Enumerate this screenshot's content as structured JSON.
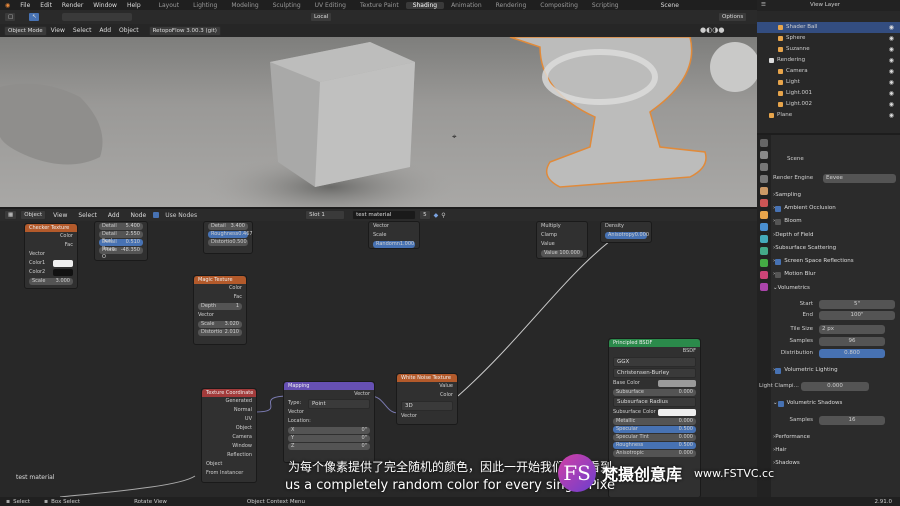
{
  "menu": [
    "File",
    "Edit",
    "Render",
    "Window",
    "Help"
  ],
  "workspaces": [
    "Layout",
    "Lighting",
    "Modeling",
    "Sculpting",
    "UV Editing",
    "Texture Paint",
    "Shading",
    "Animation",
    "Rendering",
    "Compositing",
    "Scripting"
  ],
  "active_workspace": "Shading",
  "scene_label": "Scene",
  "view_layer_label": "View Layer",
  "viewport": {
    "mode": "Object Mode",
    "menus": [
      "View",
      "Select",
      "Add",
      "Object"
    ],
    "addon": "RetopoFlow 3.00.3 (git)",
    "transform": "Local",
    "options": "Options"
  },
  "node_editor": {
    "editor_type": "Object",
    "menus": [
      "View",
      "Select",
      "Add",
      "Node"
    ],
    "use_nodes": "Use Nodes",
    "slot": "Slot 1",
    "material": "test material",
    "users": "5",
    "material_label": "test material"
  },
  "nodes": {
    "checker": {
      "title": "Checker Texture",
      "out": [
        "Color",
        "Fac"
      ],
      "in": [
        "Vector",
        "Color1",
        "Color2"
      ],
      "scale_label": "Scale",
      "scale": "3.000"
    },
    "noise_top": {
      "rows": [
        [
          "Detail",
          "5.400"
        ],
        [
          "Detail Scal",
          "2.550"
        ],
        [
          "Detail Roug",
          "0.510"
        ],
        [
          "Phase O",
          "-48.350"
        ]
      ]
    },
    "voronoi_top": {
      "rows": [
        [
          "Detail",
          "3.400"
        ],
        [
          "Roughness",
          "0.467"
        ],
        [
          "Distortio",
          "0.500"
        ]
      ]
    },
    "vec_top": {
      "rows": [
        "Vector",
        "Scale"
      ],
      "rand_label": "Randomn",
      "rand": "1.000"
    },
    "magic": {
      "title": "Magic Texture",
      "out": [
        "Color",
        "Fac"
      ],
      "depth_label": "Depth",
      "depth": "1",
      "in": [
        "Vector"
      ],
      "scale_label": "Scale",
      "scale": "3.020",
      "dist_label": "Distortio",
      "dist": "2.010"
    },
    "math_top": {
      "rows": [
        "Multiply",
        "Clamp",
        "Value"
      ],
      "value_label": "Value",
      "value": "100.000"
    },
    "vol_top": {
      "rows": [
        "Density"
      ],
      "aniso_label": "Anisotropy",
      "aniso": "0.000"
    },
    "texcoord": {
      "title": "Texture Coordinate",
      "out": [
        "Generated",
        "Normal",
        "UV",
        "Object",
        "Camera",
        "Window",
        "Reflection"
      ],
      "obj_label": "Object",
      "from_inst": "From Instancer"
    },
    "mapping": {
      "title": "Mapping",
      "out": "Vector",
      "type_label": "Type:",
      "type": "Point",
      "in": [
        "Vector",
        "Location:"
      ],
      "loc": [
        [
          "X",
          "0\""
        ],
        [
          "Y",
          "0\""
        ],
        [
          "Z",
          "0\""
        ]
      ]
    },
    "white_noise": {
      "title": "White Noise Texture",
      "out": [
        "Value",
        "Color"
      ],
      "dim": "3D",
      "in": "Vector"
    },
    "principled": {
      "title": "Principled BSDF",
      "out": "BSDF",
      "dist": "GGX",
      "ss_method": "Christensen-Burley",
      "rows": [
        [
          "Base Color",
          ""
        ],
        [
          "Subsurface",
          "0.000"
        ],
        [
          "Subsurface Radius",
          ""
        ],
        [
          "Subsurface Color",
          ""
        ],
        [
          "Metallic",
          "0.000"
        ],
        [
          "Specular",
          "0.500"
        ],
        [
          "Specular Tint",
          "0.000"
        ],
        [
          "Roughness",
          "0.500"
        ],
        [
          "Anisotropic",
          "0.000"
        ]
      ]
    }
  },
  "outliner": {
    "rows": [
      {
        "label": "Shader Ball",
        "indent": 2,
        "sel": true,
        "color": "#e8a54b"
      },
      {
        "label": "Sphere",
        "indent": 2,
        "sel": false,
        "color": "#e8a54b"
      },
      {
        "label": "Suzanne",
        "indent": 2,
        "sel": false,
        "color": "#e8a54b"
      },
      {
        "label": "Rendering",
        "indent": 1,
        "sel": false,
        "color": "#dddddd"
      },
      {
        "label": "Camera",
        "indent": 2,
        "sel": false,
        "color": "#e8a54b"
      },
      {
        "label": "Light",
        "indent": 2,
        "sel": false,
        "color": "#e8a54b"
      },
      {
        "label": "Light.001",
        "indent": 2,
        "sel": false,
        "color": "#e8a54b"
      },
      {
        "label": "Light.002",
        "indent": 2,
        "sel": false,
        "color": "#e8a54b"
      },
      {
        "label": "Plane",
        "indent": 1,
        "sel": false,
        "color": "#e8a54b"
      }
    ]
  },
  "properties": {
    "scene": "Scene",
    "engine_label": "Render Engine",
    "engine": "Eevee",
    "sampling": "Sampling",
    "ao": "Ambient Occlusion",
    "bloom": "Bloom",
    "dof": "Depth of Field",
    "sss": "Subsurface Scattering",
    "ssr": "Screen Space Reflections",
    "mblur": "Motion Blur",
    "volumetrics": "Volumetrics",
    "start_label": "Start",
    "start": "5\"",
    "end_label": "End",
    "end": "100\"",
    "tile_label": "Tile Size",
    "tile": "2 px",
    "samples_label": "Samples",
    "samples": "96",
    "dist_label": "Distribution",
    "dist": "0.800",
    "vol_light": "Volumetric Lighting",
    "light_clamp": "Light Clampi...",
    "light_clamp_val": "0.000",
    "vol_shadows": "Volumetric Shadows",
    "shadow_samples_label": "Samples",
    "shadow_samples": "16",
    "performance": "Performance",
    "hair": "Hair",
    "shadows": "Shadows"
  },
  "status": {
    "select": "Select",
    "box": "Box Select",
    "rotate": "Rotate View",
    "context": "Object Context Menu",
    "version": "2.91.0"
  },
  "subtitles": {
    "cn": "为每个像素提供了完全随机的颜色，因此一开始我们可以看到",
    "en": "us a completely random color for every single Pixe"
  },
  "watermark": {
    "logo": "FS",
    "cn": "梵摄创意库",
    "url": "www.FSTVC.cc"
  },
  "colors": {
    "accent": "#4772b3",
    "selected": "#334d80",
    "node_green": "#2b8a4b",
    "node_orange": "#b35a2b",
    "node_purple": "#6650b3",
    "node_red": "#a33b3b"
  }
}
